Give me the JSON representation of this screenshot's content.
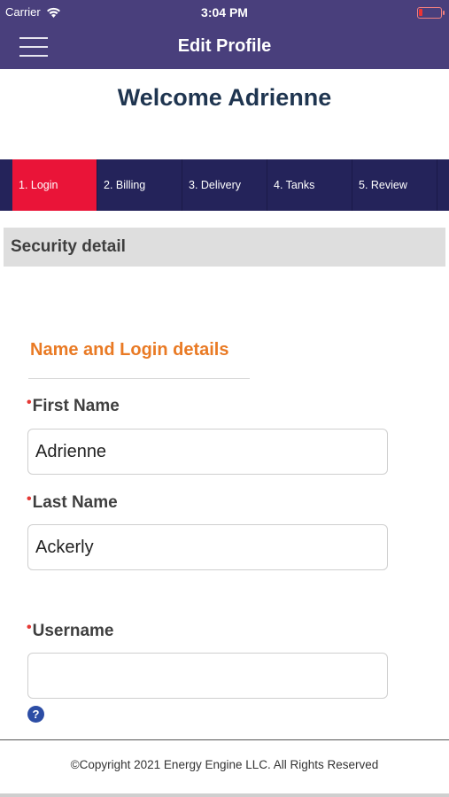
{
  "status_bar": {
    "carrier": "Carrier",
    "time": "3:04 PM",
    "wifi_icon": "wifi-icon",
    "battery_icon": "battery-icon"
  },
  "header": {
    "title": "Edit Profile",
    "menu_icon": "hamburger-menu-icon",
    "background": "#493f7c"
  },
  "welcome": "Welcome Adrienne",
  "steps": {
    "items": [
      {
        "label": "1. Login"
      },
      {
        "label": "2. Billing"
      },
      {
        "label": "3. Delivery"
      },
      {
        "label": "4. Tanks"
      },
      {
        "label": "5. Review"
      }
    ],
    "active_index": 0,
    "active_color": "#ea1438",
    "bar_color": "#24235a"
  },
  "section": {
    "title": "Security detail"
  },
  "form": {
    "group_title": "Name and Login details",
    "group_title_color": "#e97a24",
    "required_marker": "•",
    "first_name": {
      "label": "First Name",
      "value": "Adrienne"
    },
    "last_name": {
      "label": "Last Name",
      "value": "Ackerly"
    },
    "username": {
      "label": "Username",
      "value": ""
    },
    "help_icon": {
      "name": "help-icon",
      "glyph": "?"
    }
  },
  "footer": {
    "text": "©Copyright 2021 Energy Engine LLC. All Rights Reserved"
  }
}
